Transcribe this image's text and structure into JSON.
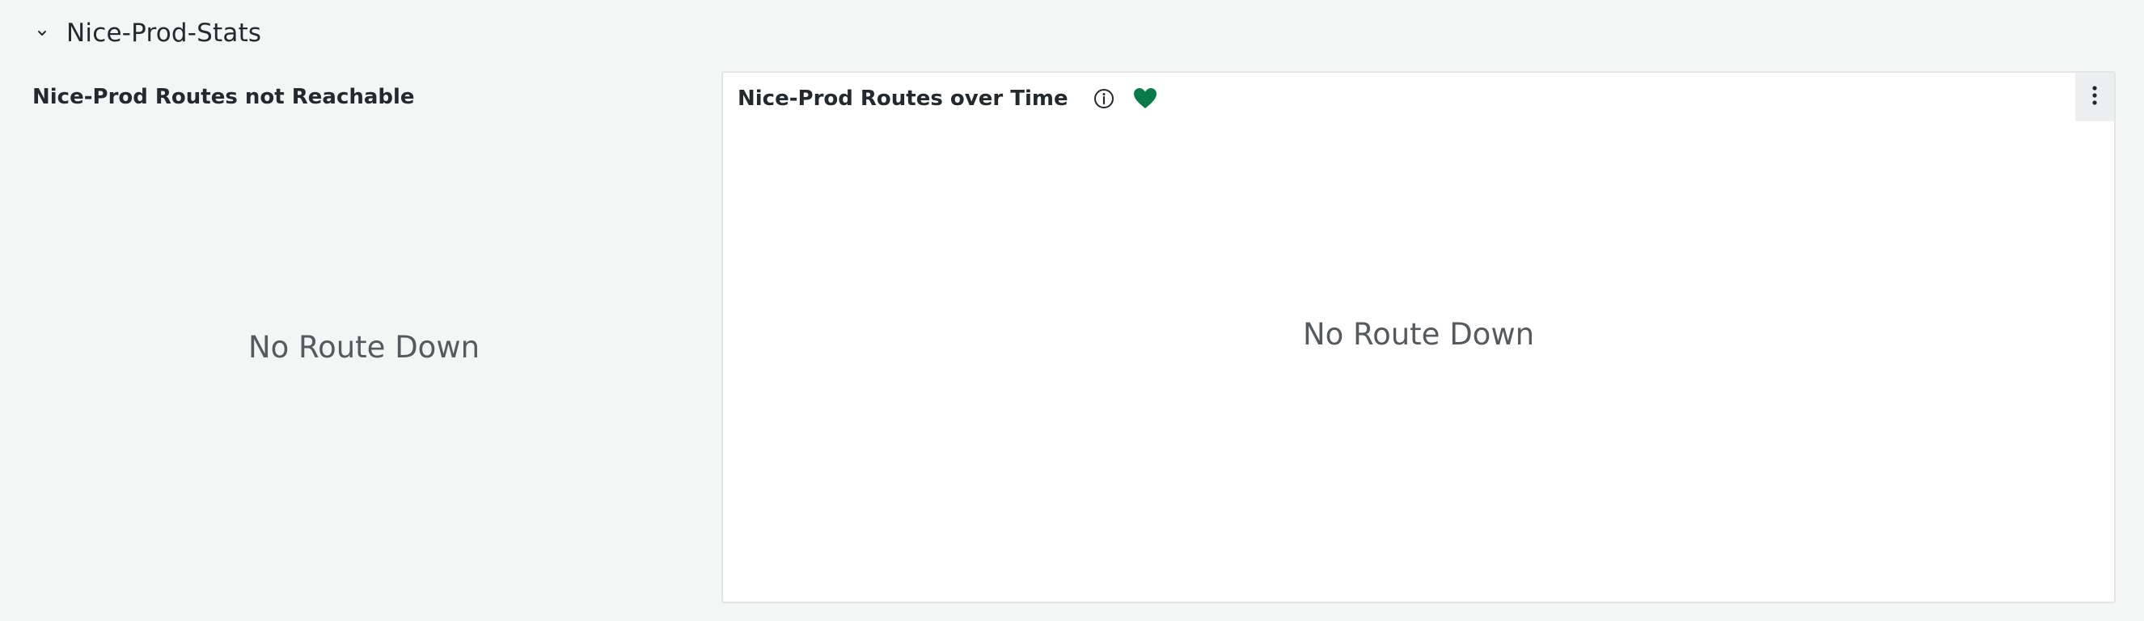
{
  "row": {
    "title": "Nice-Prod-Stats",
    "chevron_icon": "chevron-down-icon"
  },
  "panels": {
    "left": {
      "title": "Nice-Prod Routes not Reachable",
      "message": "No Route Down"
    },
    "right": {
      "title": "Nice-Prod Routes over Time",
      "message": "No Route Down",
      "info_icon": "info-icon",
      "health_icon": "heart-icon",
      "health_color": "#0b7a4b",
      "menu_icon": "vertical-ellipsis-icon"
    }
  }
}
